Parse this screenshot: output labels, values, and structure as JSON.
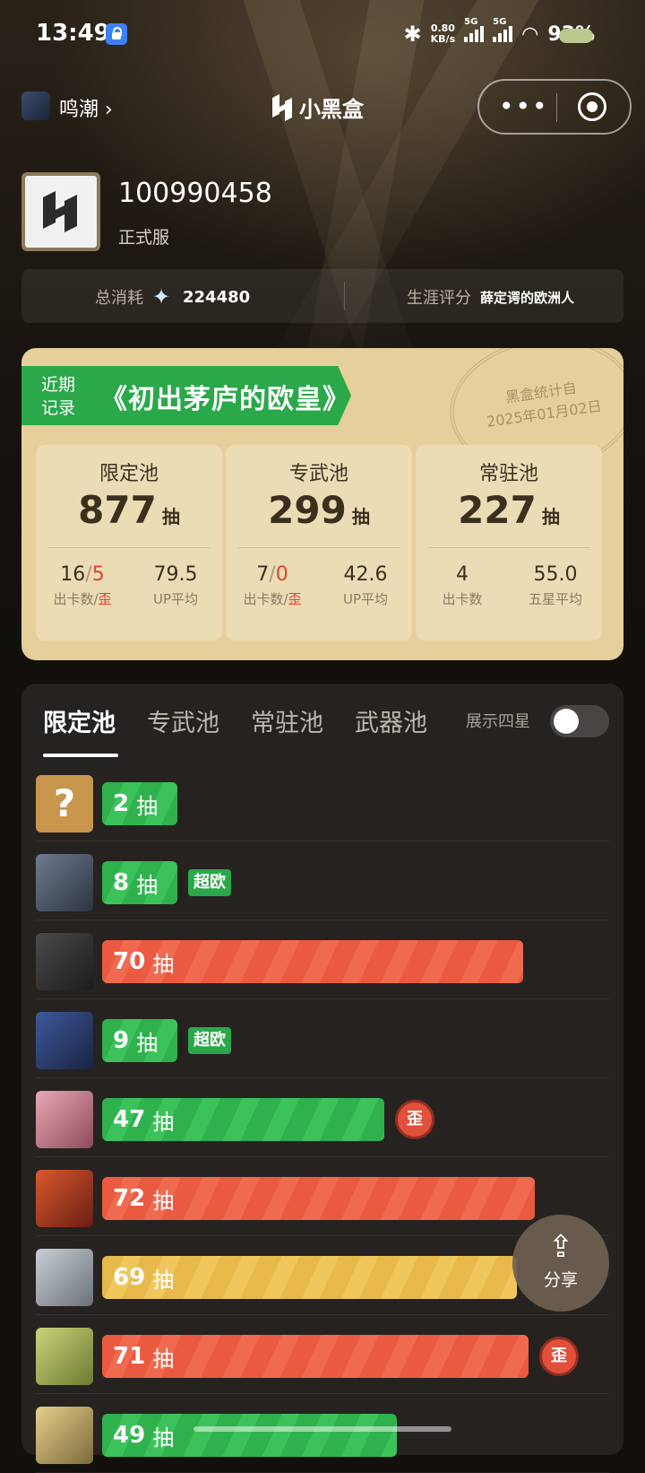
{
  "status_bar": {
    "time": "13:49",
    "net_speed_value": "0.80",
    "net_speed_unit": "KB/s",
    "sim1": "5G",
    "sim2": "5G",
    "battery": "93%"
  },
  "nav": {
    "game_name": "鸣潮",
    "brand": "小黑盒",
    "more_glyph": "•••"
  },
  "profile": {
    "uid": "100990458",
    "server": "正式服"
  },
  "stats": {
    "total_label": "总消耗",
    "total_value": "224480",
    "career_label": "生涯评分",
    "career_value": "薛定谔的欧洲人"
  },
  "recent": {
    "tag_line1": "近期",
    "tag_line2": "记录",
    "title": "《初出茅庐的欧皇》",
    "stamp_line1": "黑盒统计自",
    "stamp_line2": "2025年01月02日",
    "pools": [
      {
        "name": "限定池",
        "count": "877",
        "unit": "抽",
        "a_main": "16",
        "a_sep": "/",
        "a_red": "5",
        "a_label": "出卡数/",
        "a_label_red": "歪",
        "b_value": "79.5",
        "b_label": "UP平均"
      },
      {
        "name": "专武池",
        "count": "299",
        "unit": "抽",
        "a_main": "7",
        "a_sep": "/",
        "a_red": "0",
        "a_label": "出卡数/",
        "a_label_red": "歪",
        "b_value": "42.6",
        "b_label": "UP平均"
      },
      {
        "name": "常驻池",
        "count": "227",
        "unit": "抽",
        "a_main": "4",
        "a_sep": "",
        "a_red": "",
        "a_label": "出卡数",
        "a_label_red": "",
        "b_value": "55.0",
        "b_label": "五星平均"
      }
    ]
  },
  "tabs": {
    "items": [
      "限定池",
      "专武池",
      "常驻池",
      "武器池"
    ],
    "active": "限定池",
    "four_star_label": "展示四星",
    "four_star_on": false
  },
  "pulls": [
    {
      "count": "2",
      "unit": "抽",
      "level": 2,
      "color": "green",
      "badge": "",
      "wai": false,
      "unknown": true,
      "char_icon": "question-mark"
    },
    {
      "count": "8",
      "unit": "抽",
      "level": 8,
      "color": "green",
      "badge": "超欧",
      "wai": false,
      "unknown": false,
      "char_icon": "character-avatar"
    },
    {
      "count": "70",
      "unit": "抽",
      "level": 70,
      "color": "red",
      "badge": "",
      "wai": false,
      "unknown": false,
      "char_icon": "character-avatar"
    },
    {
      "count": "9",
      "unit": "抽",
      "level": 9,
      "color": "green",
      "badge": "超欧",
      "wai": false,
      "unknown": false,
      "char_icon": "character-avatar"
    },
    {
      "count": "47",
      "unit": "抽",
      "level": 47,
      "color": "green",
      "badge": "",
      "wai": true,
      "unknown": false,
      "char_icon": "character-avatar"
    },
    {
      "count": "72",
      "unit": "抽",
      "level": 72,
      "color": "red",
      "badge": "",
      "wai": false,
      "unknown": false,
      "char_icon": "character-avatar"
    },
    {
      "count": "69",
      "unit": "抽",
      "level": 69,
      "color": "yellow",
      "badge": "",
      "wai": false,
      "unknown": false,
      "char_icon": "character-avatar"
    },
    {
      "count": "71",
      "unit": "抽",
      "level": 71,
      "color": "red",
      "badge": "",
      "wai": true,
      "unknown": false,
      "char_icon": "character-avatar"
    },
    {
      "count": "49",
      "unit": "抽",
      "level": 49,
      "color": "green",
      "badge": "",
      "wai": false,
      "unknown": false,
      "char_icon": "character-avatar"
    }
  ],
  "wai_label": "歪",
  "share": {
    "label": "分享",
    "icon": "share-icon"
  },
  "colors": {
    "green": "#2fb14d",
    "red": "#ea5a40",
    "yellow": "#e6b94a",
    "gold_card": "#e5cf9a"
  }
}
